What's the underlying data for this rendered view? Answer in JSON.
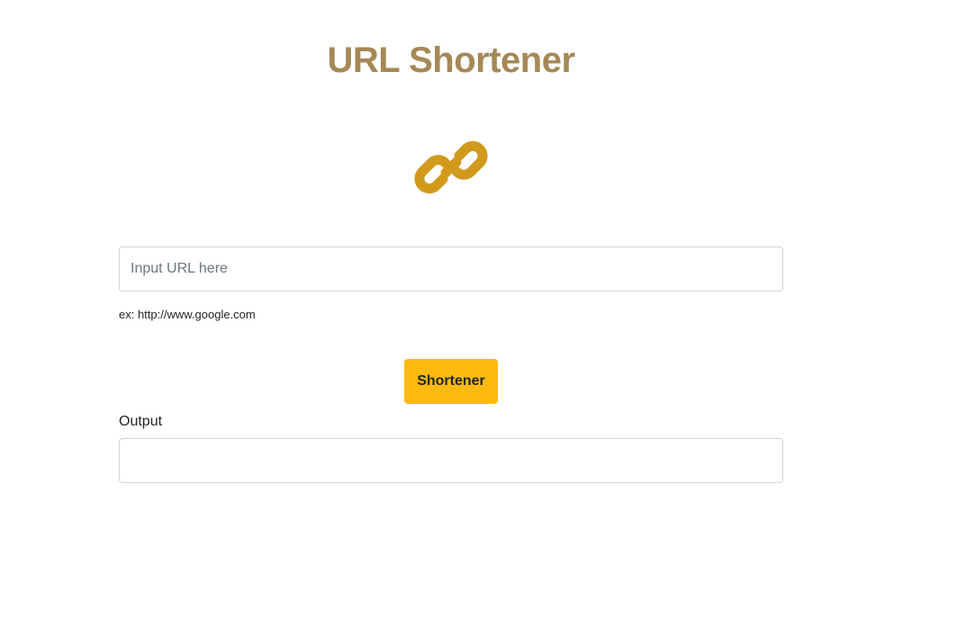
{
  "header": {
    "title": "URL Shortener",
    "title_color": "#A58855"
  },
  "logo": {
    "icon": "link-icon",
    "color": "#D19A1C"
  },
  "form": {
    "url_input": {
      "placeholder": "Input URL here",
      "value": ""
    },
    "hint": "ex: http://www.google.com",
    "submit_label": "Shortener",
    "submit_color": "#FFBA0F"
  },
  "output": {
    "label": "Output",
    "value": ""
  }
}
